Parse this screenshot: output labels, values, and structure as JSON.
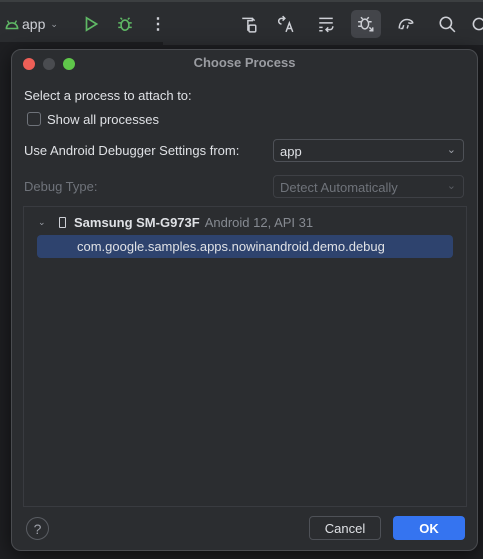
{
  "toolbar": {
    "project": "app",
    "icons": [
      "android-icon",
      "run-icon",
      "debug-icon",
      "more-icon",
      "build-icon",
      "translate-icon",
      "sync-icon",
      "attach-debugger-icon",
      "gradle-icon",
      "search-icon",
      "settings-icon"
    ]
  },
  "dialog": {
    "title": "Choose Process",
    "select_label": "Select a process to attach to:",
    "show_all_label": "Show all processes",
    "show_all_checked": false,
    "debugger_settings_label": "Use Android Debugger Settings from:",
    "debugger_settings_value": "app",
    "debug_type_label": "Debug Type:",
    "debug_type_value": "Detect Automatically",
    "device": {
      "name": "Samsung SM-G973F",
      "info": "Android 12, API 31"
    },
    "processes": [
      "com.google.samples.apps.nowinandroid.demo.debug"
    ],
    "help": "?",
    "cancel": "Cancel",
    "ok": "OK"
  },
  "colors": {
    "accent": "#3574f0",
    "selection": "#2e436e",
    "run": "#5fb865"
  }
}
